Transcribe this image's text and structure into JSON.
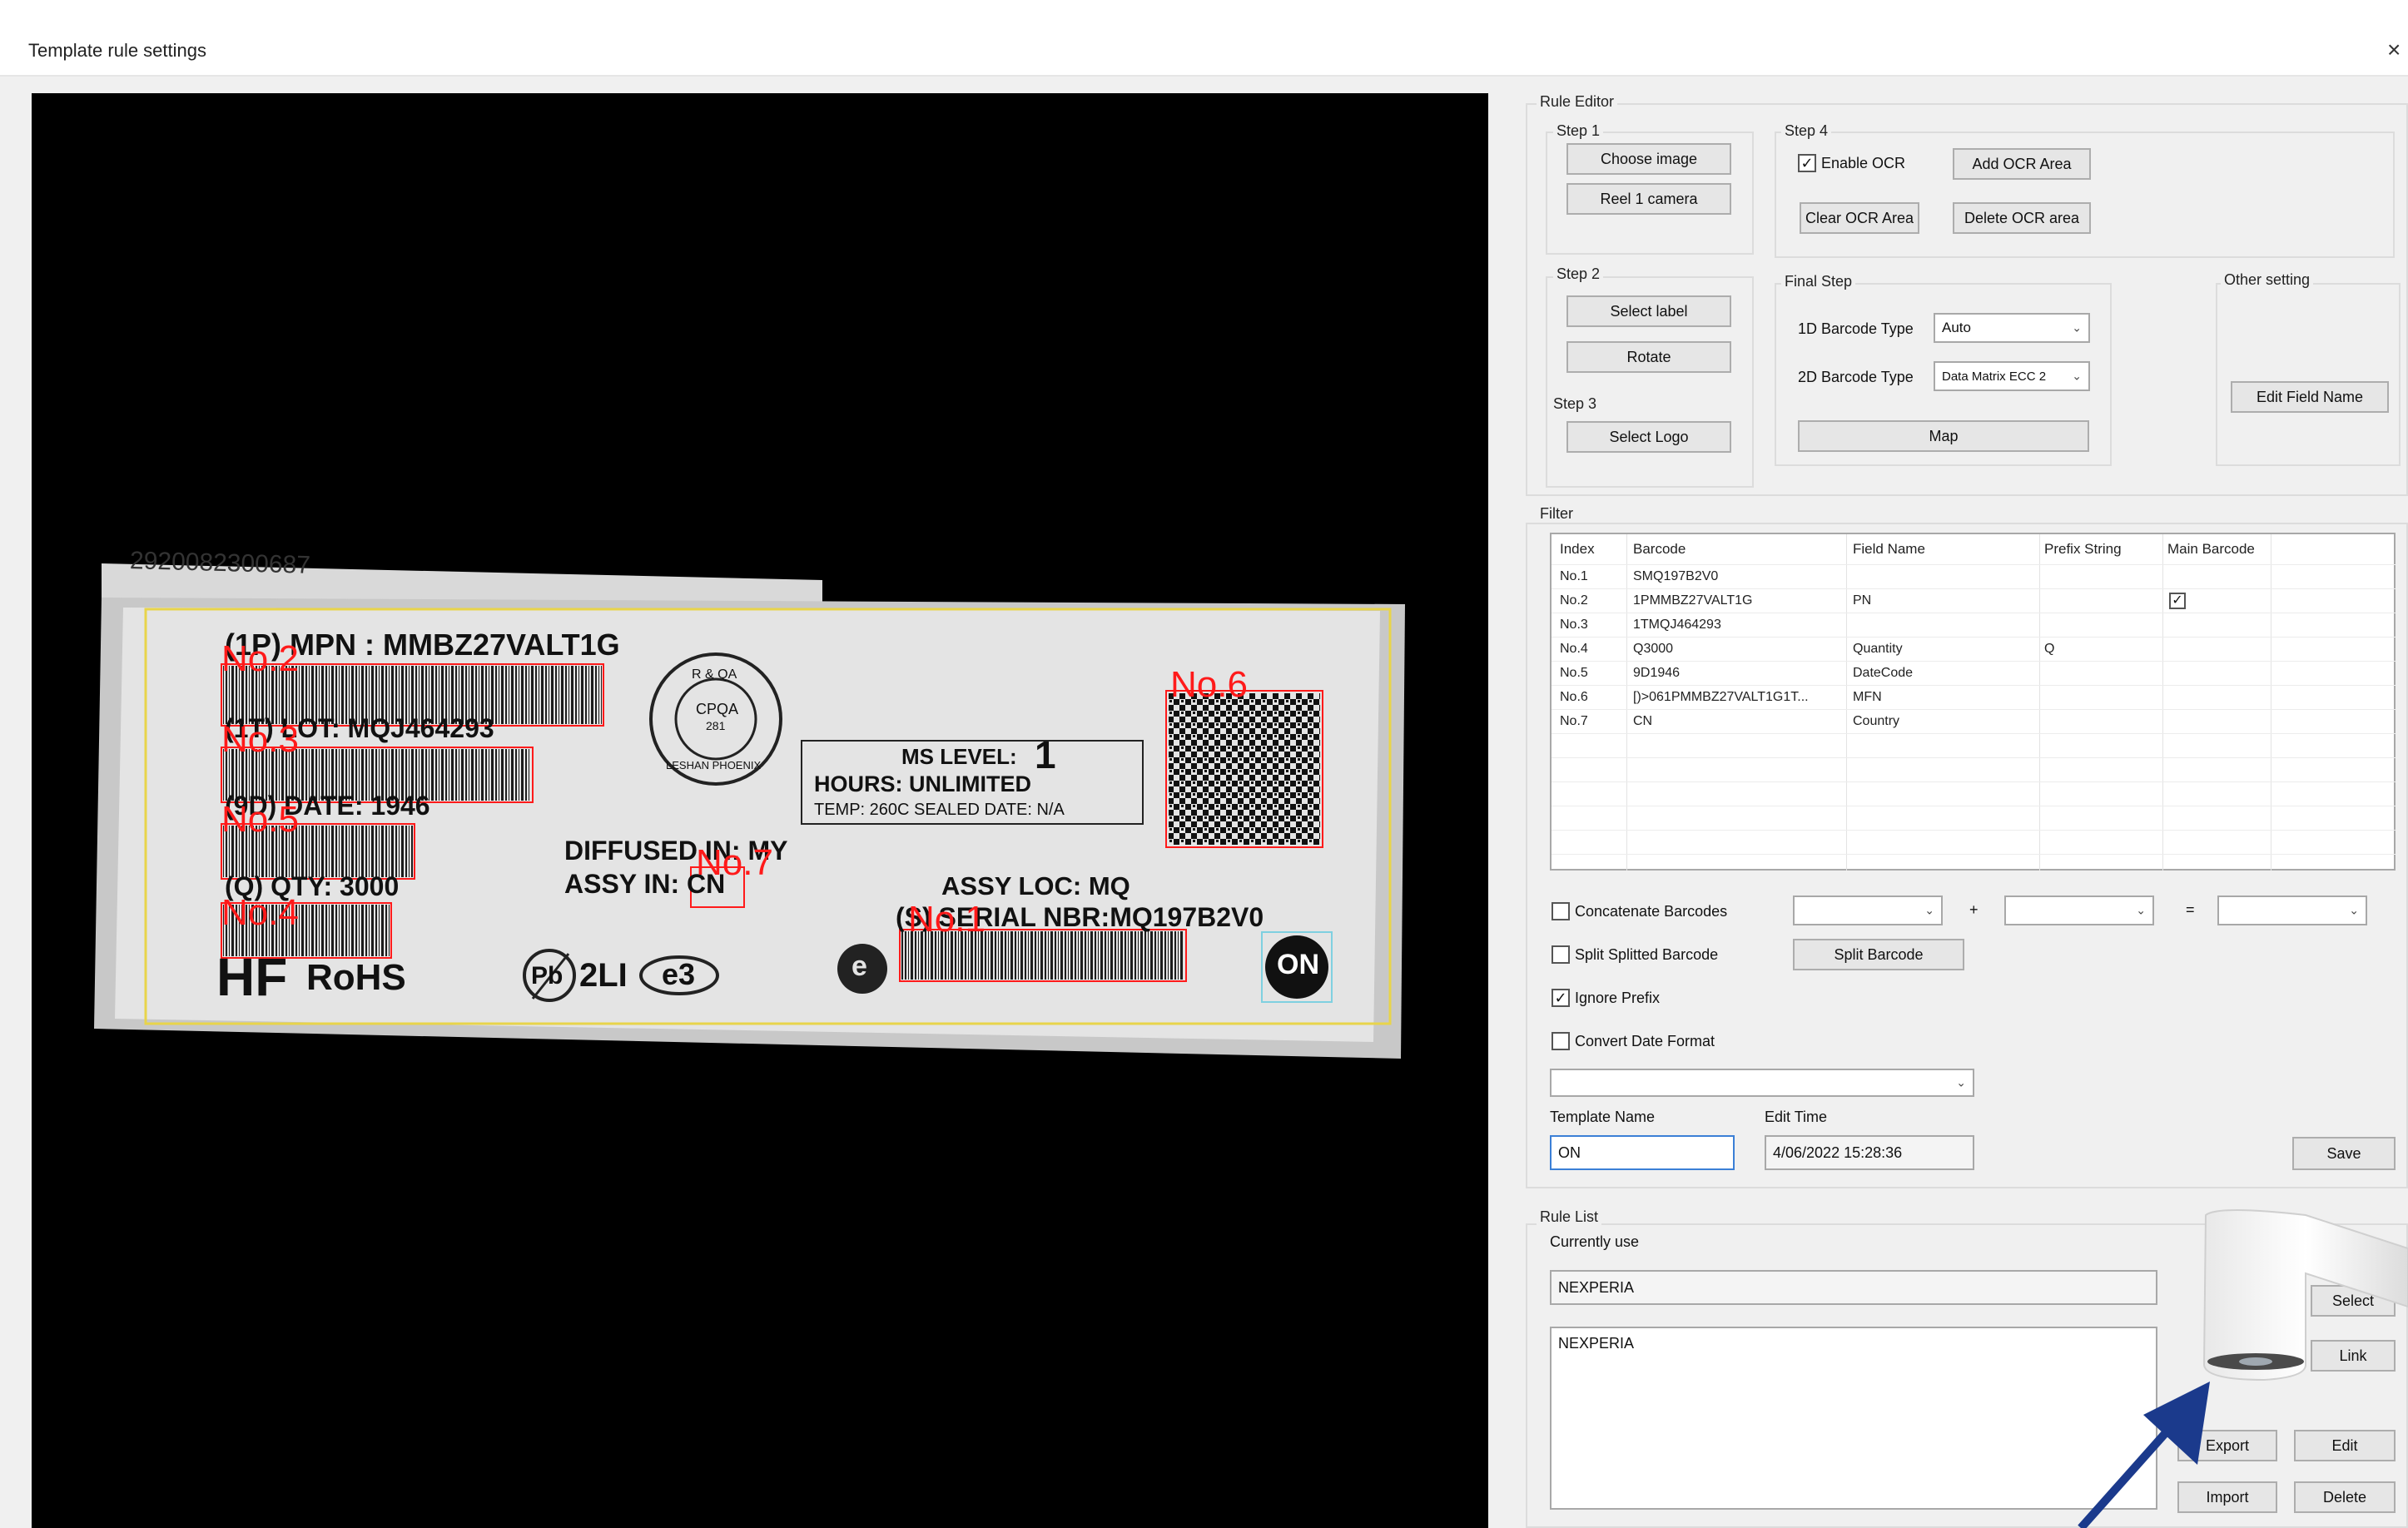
{
  "window": {
    "title": "Template rule settings",
    "close_glyph": "×"
  },
  "image": {
    "top_strip_text": "2920082300687",
    "label_lines": {
      "mpn": "(1P) MPN : MMBZ27VALT1G",
      "lot": "(1T) LOT:  MQJ464293",
      "date": "(9D) DATE:  1946",
      "qty": "(Q) QTY:   3000",
      "diffused": "DIFFUSED IN: MY",
      "assy_in": "ASSY IN: CN",
      "ms_level": "MS LEVEL:",
      "ms_level_num": "1",
      "hours": "HOURS: UNLIMITED",
      "temp": "TEMP: 260C   SEALED DATE: N/A",
      "assy_loc": "ASSY LOC: MQ",
      "serial": "(S) SERIAL NBR:MQ197B2V0",
      "hf": "HF",
      "rohs": "RoHS",
      "pb": "Pb",
      "2li": "2LI",
      "e3": "e3",
      "e_logo": "e",
      "on": "ON",
      "seal_top": "R & QA",
      "seal_mid": "CPQA",
      "seal_num": "281",
      "seal_bottom": "LESHAN PHOENIX"
    },
    "tags": [
      "No.1",
      "No.2",
      "No.3",
      "No.4",
      "No.5",
      "No.6",
      "No.7"
    ]
  },
  "rule_editor": {
    "title": "Rule Editor",
    "step1": {
      "label": "Step 1",
      "choose_image": "Choose image",
      "reel_camera": "Reel 1 camera"
    },
    "step2": {
      "label": "Step 2",
      "select_label": "Select label",
      "rotate": "Rotate"
    },
    "step3": {
      "label": "Step 3",
      "select_logo": "Select Logo"
    },
    "step4": {
      "label": "Step 4",
      "enable_ocr": "Enable OCR",
      "enable_ocr_checked": "✓",
      "add_ocr": "Add OCR Area",
      "clear_ocr": "Clear OCR Area",
      "delete_ocr": "Delete OCR area"
    },
    "final_step": {
      "label": "Final Step",
      "barcode_1d_label": "1D Barcode Type",
      "barcode_1d_value": "Auto",
      "barcode_2d_label": "2D Barcode Type",
      "barcode_2d_value": "Data Matrix ECC 2",
      "map": "Map"
    },
    "other": {
      "label": "Other setting",
      "edit_field_name": "Edit Field Name"
    }
  },
  "filter": {
    "title": "Filter",
    "columns": [
      "Index",
      "Barcode",
      "Field Name",
      "Prefix String",
      "Main Barcode"
    ],
    "rows": [
      {
        "index": "No.1",
        "barcode": "SMQ197B2V0",
        "field": "",
        "prefix": "",
        "main": ""
      },
      {
        "index": "No.2",
        "barcode": "1PMMBZ27VALT1G",
        "field": "PN",
        "prefix": "",
        "main": "✓"
      },
      {
        "index": "No.3",
        "barcode": "1TMQJ464293",
        "field": "",
        "prefix": "",
        "main": ""
      },
      {
        "index": "No.4",
        "barcode": "Q3000",
        "field": "Quantity",
        "prefix": "Q",
        "main": ""
      },
      {
        "index": "No.5",
        "barcode": "9D1946",
        "field": "DateCode",
        "prefix": "",
        "main": ""
      },
      {
        "index": "No.6",
        "barcode": "[)>061PMMBZ27VALT1G1T...",
        "field": "MFN",
        "prefix": "",
        "main": ""
      },
      {
        "index": "No.7",
        "barcode": "CN",
        "field": "Country",
        "prefix": "",
        "main": ""
      }
    ],
    "concatenate": "Concatenate Barcodes",
    "plus": "+",
    "equals": "=",
    "split": "Split Splitted Barcode",
    "split_button": "Split Barcode",
    "ignore_prefix": "Ignore Prefix",
    "ignore_prefix_checked": "✓",
    "convert_date": "Convert Date Format",
    "template_name_label": "Template Name",
    "template_name_value": "ON",
    "edit_time_label": "Edit Time",
    "edit_time_value": "4/06/2022 15:28:36",
    "save": "Save"
  },
  "rule_list": {
    "title": "Rule List",
    "currently_use_label": "Currently use",
    "currently_use_value": "NEXPERIA",
    "list_item": "NEXPERIA",
    "select": "Select",
    "link": "Link",
    "export": "Export",
    "edit": "Edit",
    "import": "Import",
    "delete": "Delete"
  },
  "colors": {
    "accent_red": "#ff1a1a",
    "pointer_blue": "#1b3a8c",
    "yellow_box": "#e8d44a"
  }
}
